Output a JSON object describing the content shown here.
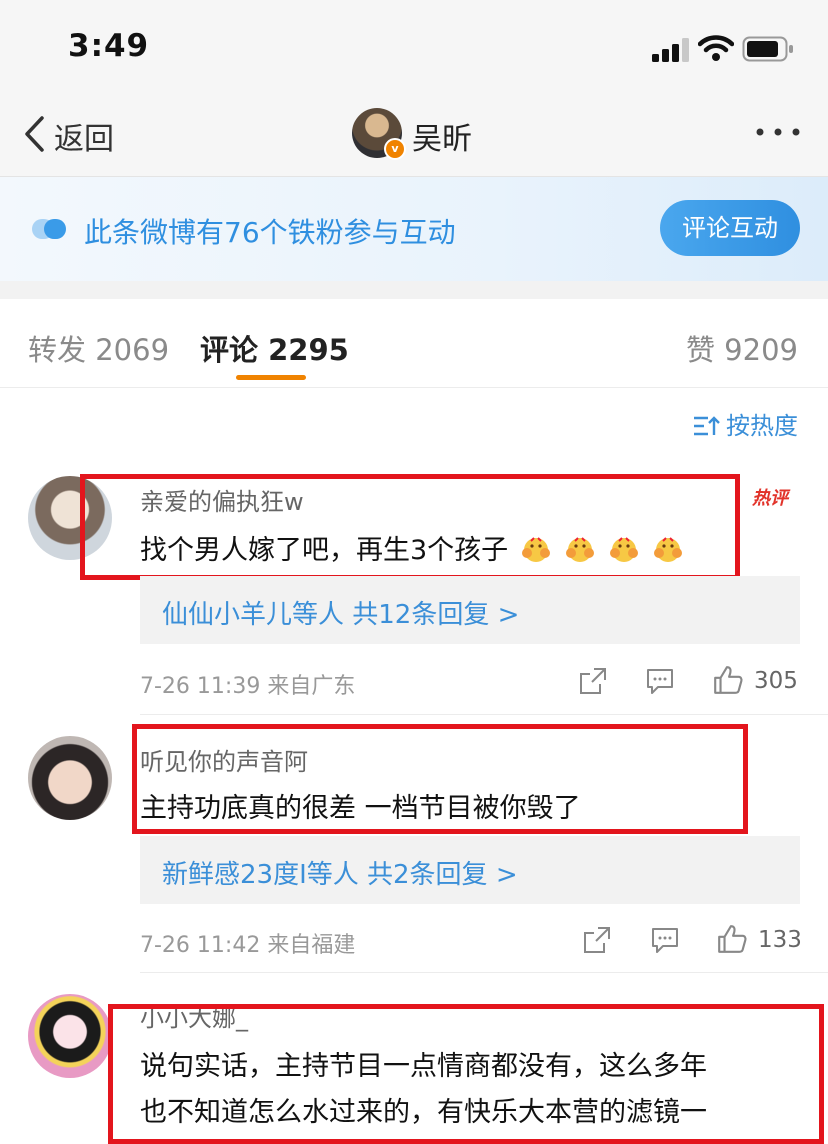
{
  "status_bar": {
    "time": "3:49"
  },
  "nav": {
    "back_label": "返回",
    "title": "吴昕"
  },
  "banner": {
    "text": "此条微博有76个铁粉参与互动",
    "button": "评论互动"
  },
  "tabs": [
    {
      "label": "转发 2069"
    },
    {
      "label": "评论 2295",
      "active": true
    },
    {
      "label": "赞 9209"
    }
  ],
  "sort": {
    "label": "按热度"
  },
  "colors": {
    "accent": "#f08300",
    "link": "#3b8fd8",
    "highlight_box": "#e3151d"
  },
  "comments": [
    {
      "username": "亲爱的偏执狂w",
      "content": "找个男人嫁了吧，再生3个孩子",
      "emoji_count": 4,
      "hot_badge": "热评",
      "replies": "仙仙小羊儿等人  共12条回复 >",
      "meta": "7-26 11:39  来自广东",
      "likes": "305"
    },
    {
      "username": "听见你的声音阿",
      "content": "主持功底真的很差 一档节目被你毁了",
      "replies": "新鲜感23度I等人  共2条回复 >",
      "meta": "7-26 11:42  来自福建",
      "likes": "133"
    },
    {
      "username": "小小大娜_",
      "content_lines": [
        "说句实话，主持节目一点情商都没有，这么多年",
        "也不知道怎么水过来的，有快乐大本营的滤镜一"
      ]
    }
  ]
}
